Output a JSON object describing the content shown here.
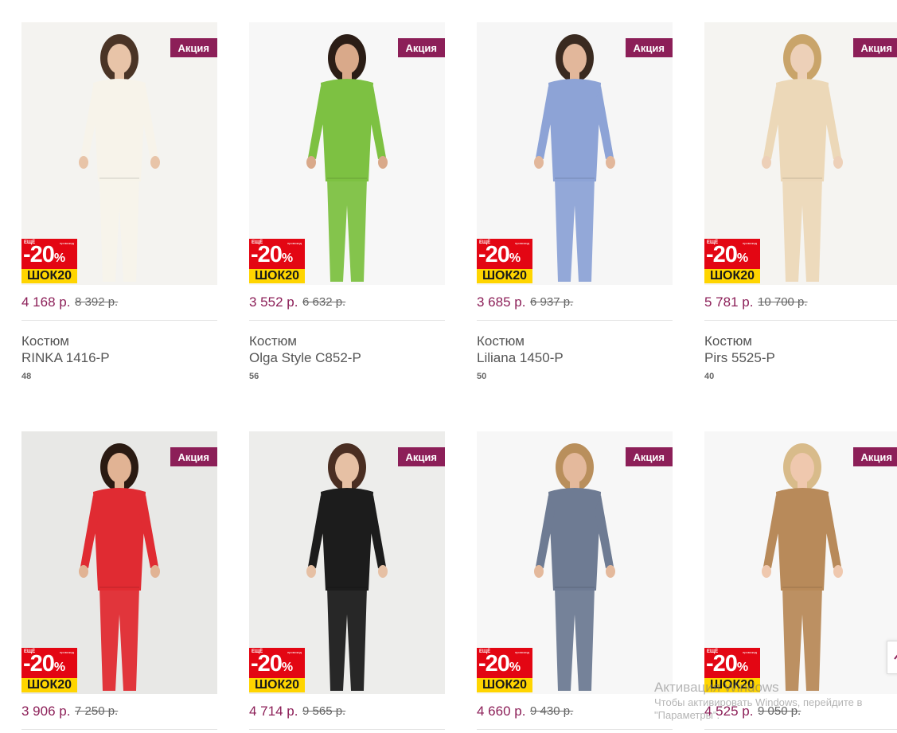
{
  "products": [
    {
      "badge": "Акция",
      "promo_more": "ЕЩЁ",
      "promo_label": "промокод",
      "promo_discount": "-20",
      "promo_percent": "%",
      "promo_code": "ШОК20",
      "price": "4 168 р.",
      "old_price": "8 392 р.",
      "type": "Костюм",
      "name": "RINKA 1416-P",
      "size": "48",
      "bg": "#f4f3f0",
      "outfit": "#f7f3ea",
      "hair": "#4a3426",
      "skin": "#e8c4a8"
    },
    {
      "badge": "Акция",
      "promo_more": "ЕЩЁ",
      "promo_label": "промокод",
      "promo_discount": "-20",
      "promo_percent": "%",
      "promo_code": "ШОК20",
      "price": "3 552 р.",
      "old_price": "6 632 р.",
      "type": "Костюм",
      "name": "Olga Style C852-P",
      "size": "56",
      "bg": "#f7f7f7",
      "outfit": "#7dc142",
      "hair": "#2b1d16",
      "skin": "#d9a98a"
    },
    {
      "badge": "Акция",
      "promo_more": "ЕЩЁ",
      "promo_label": "промокод",
      "promo_discount": "-20",
      "promo_percent": "%",
      "promo_code": "ШОК20",
      "price": "3 685 р.",
      "old_price": "6 937 р.",
      "type": "Костюм",
      "name": "Liliana 1450-P",
      "size": "50",
      "bg": "#f6f6f6",
      "outfit": "#8da3d6",
      "hair": "#3a2a20",
      "skin": "#e2b79b"
    },
    {
      "badge": "Акция",
      "promo_more": "ЕЩЁ",
      "promo_label": "промокод",
      "promo_discount": "-20",
      "promo_percent": "%",
      "promo_code": "ШОК20",
      "price": "5 781 р.",
      "old_price": "10 700 р.",
      "type": "Костюм",
      "name": "Pirs 5525-P",
      "size": "40",
      "bg": "#f5f4f1",
      "outfit": "#ecd8b8",
      "hair": "#c9a46a",
      "skin": "#edd0b8"
    },
    {
      "badge": "Акция",
      "promo_more": "ЕЩЁ",
      "promo_label": "промокод",
      "promo_discount": "-20",
      "promo_percent": "%",
      "promo_code": "ШОК20",
      "price": "3 906 р.",
      "old_price": "7 250 р.",
      "type": "",
      "name": "",
      "size": "",
      "bg": "#e8e8e6",
      "outfit": "#e02b32",
      "hair": "#2a1a12",
      "skin": "#e1b394"
    },
    {
      "badge": "Акция",
      "promo_more": "ЕЩЁ",
      "promo_label": "промокод",
      "promo_discount": "-20",
      "promo_percent": "%",
      "promo_code": "ШОК20",
      "price": "4 714 р.",
      "old_price": "9 565 р.",
      "type": "",
      "name": "",
      "size": "",
      "bg": "#ededeb",
      "outfit": "#1c1c1c",
      "hair": "#4a2e22",
      "skin": "#e6c0a4"
    },
    {
      "badge": "Акция",
      "promo_more": "ЕЩЁ",
      "promo_label": "промокод",
      "promo_discount": "-20",
      "promo_percent": "%",
      "promo_code": "ШОК20",
      "price": "4 660 р.",
      "old_price": "9 430 р.",
      "type": "",
      "name": "",
      "size": "",
      "bg": "#f7f7f7",
      "outfit": "#6e7b93",
      "hair": "#b98f5c",
      "skin": "#e4b99c"
    },
    {
      "badge": "Акция",
      "promo_more": "ЕЩЁ",
      "promo_label": "промокод",
      "promo_discount": "-20",
      "promo_percent": "%",
      "promo_code": "ШОК20",
      "price": "4 525 р.",
      "old_price": "9 050 р.",
      "type": "",
      "name": "",
      "size": "",
      "bg": "#f7f7f7",
      "outfit": "#b88a5a",
      "hair": "#d8bb8a",
      "skin": "#efc8ae"
    }
  ],
  "watermark": {
    "title": "Активация Windows",
    "subtitle": "Чтобы активировать Windows, перейдите в",
    "subtitle2": "\"Параметры\"."
  },
  "colors": {
    "brand": "#8c1f58",
    "promo_red": "#e30613",
    "promo_yellow": "#ffd500"
  },
  "icons": {
    "scroll_top": "arrow-up-icon"
  }
}
